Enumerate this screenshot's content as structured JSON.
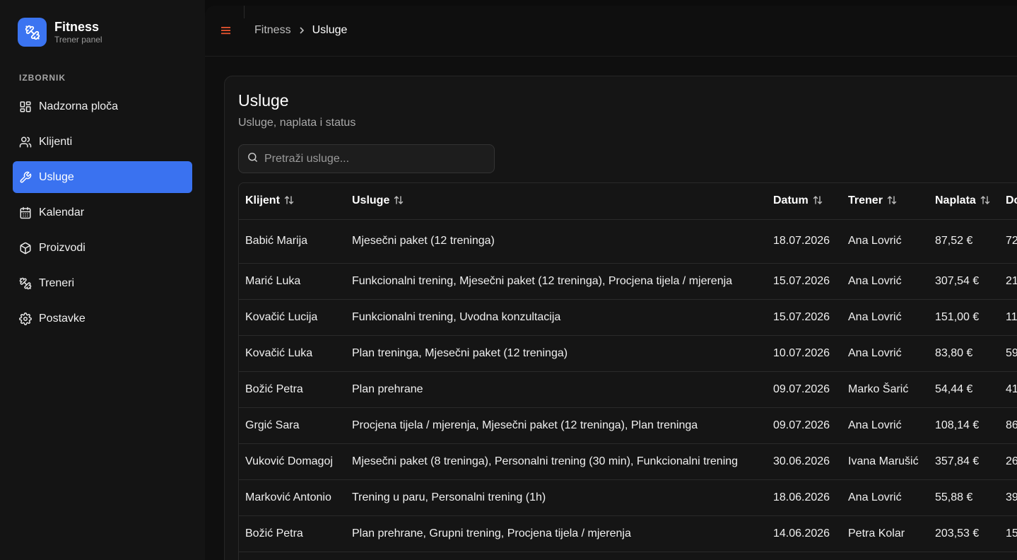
{
  "brand": {
    "title": "Fitness",
    "subtitle": "Trener panel",
    "logo_icon": "dumbbell-icon",
    "accent": "#3b74f1"
  },
  "sidebar": {
    "section_label": "IZBORNIK",
    "items": [
      {
        "label": "Nadzorna ploča",
        "icon": "dashboard-icon"
      },
      {
        "label": "Klijenti",
        "icon": "users-icon"
      },
      {
        "label": "Usluge",
        "icon": "wrench-icon",
        "active": true
      },
      {
        "label": "Kalendar",
        "icon": "calendar-icon"
      },
      {
        "label": "Proizvodi",
        "icon": "box-icon"
      },
      {
        "label": "Treneri",
        "icon": "dumbbell-icon"
      },
      {
        "label": "Postavke",
        "icon": "gear-icon"
      }
    ]
  },
  "topbar": {
    "menu_icon": "hamburger-icon",
    "breadcrumb_parent": "Fitness",
    "breadcrumb_current": "Usluge"
  },
  "page": {
    "title": "Usluge",
    "subtitle": "Usluge, naplata i status",
    "search_placeholder": "Pretraži usluge..."
  },
  "table": {
    "columns": [
      "Klijent",
      "Usluge",
      "Datum",
      "Trener",
      "Naplata",
      "Do"
    ],
    "rows": [
      [
        "Babić Marija",
        "Mjesečni paket (12 treninga)",
        "18.07.2026",
        "Ana Lovrić",
        "87,52 €",
        "72"
      ],
      [
        "Marić Luka",
        "Funkcionalni trening, Mjesečni paket (12 treninga), Procjena tijela / mjerenja",
        "15.07.2026",
        "Ana Lovrić",
        "307,54 €",
        "21"
      ],
      [
        "Kovačić Lucija",
        "Funkcionalni trening, Uvodna konzultacija",
        "15.07.2026",
        "Ana Lovrić",
        "151,00 €",
        "11"
      ],
      [
        "Kovačić Luka",
        "Plan treninga, Mjesečni paket (12 treninga)",
        "10.07.2026",
        "Ana Lovrić",
        "83,80 €",
        "59"
      ],
      [
        "Božić Petra",
        "Plan prehrane",
        "09.07.2026",
        "Marko Šarić",
        "54,44 €",
        "41"
      ],
      [
        "Grgić Sara",
        "Procjena tijela / mjerenja, Mjesečni paket (12 treninga), Plan treninga",
        "09.07.2026",
        "Ana Lovrić",
        "108,14 €",
        "86"
      ],
      [
        "Vuković Domagoj",
        "Mjesečni paket (8 treninga), Personalni trening (30 min), Funkcionalni trening",
        "30.06.2026",
        "Ivana Marušić",
        "357,84 €",
        "26"
      ],
      [
        "Marković Antonio",
        "Trening u paru, Personalni trening (1h)",
        "18.06.2026",
        "Ana Lovrić",
        "55,88 €",
        "39"
      ],
      [
        "Božić Petra",
        "Plan prehrane, Grupni trening, Procjena tijela / mjerenja",
        "14.06.2026",
        "Petra Kolar",
        "203,53 €",
        "15"
      ]
    ]
  }
}
